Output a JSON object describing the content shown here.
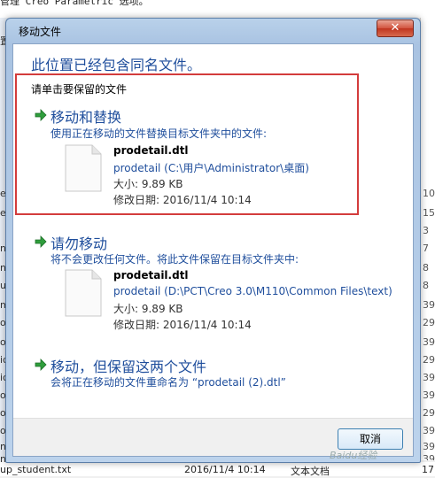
{
  "background": {
    "top_text": "管理 Creo Parametric 选项。",
    "left_snippets": [
      "置",
      "et",
      "et",
      "n_",
      "n_",
      "ug",
      "mp",
      "olu",
      "olu",
      "ic",
      "ic",
      "olg",
      "olg",
      "ol",
      "n_",
      "n_"
    ],
    "right_snippets": [
      "10",
      "15",
      "3",
      "7",
      "8",
      "8",
      "39",
      "29",
      "39",
      "29",
      "39",
      "39",
      "29",
      "39",
      "39",
      "39"
    ],
    "bottom_row": {
      "name": "up_student.txt",
      "date": "2016/11/4 10:14",
      "type": "文本文档",
      "size": "17"
    }
  },
  "dialog": {
    "title": "移动文件",
    "close_symbol": "✕",
    "heading": "此位置已经包含同名文件。",
    "instruction": "请单击要保留的文件",
    "options": [
      {
        "title": "移动和替换",
        "description": "使用正在移动的文件替换目标文件夹中的文件:",
        "file": {
          "name": "prodetail.dtl",
          "path": "prodetail (C:\\用户\\Administrator\\桌面)",
          "size": "大小: 9.89 KB",
          "modified": "修改日期: 2016/11/4 10:14"
        }
      },
      {
        "title": "请勿移动",
        "description": "将不会更改任何文件。将此文件保留在目标文件夹中:",
        "file": {
          "name": "prodetail.dtl",
          "path": "prodetail (D:\\PCT\\Creo 3.0\\M110\\Common Files\\text)",
          "size": "大小: 9.89 KB",
          "modified": "修改日期: 2016/11/4 10:14"
        }
      },
      {
        "title": "移动，但保留这两个文件",
        "description": "会将正在移动的文件重命名为 “prodetail (2).dtl”"
      }
    ],
    "cancel_label": "取消"
  },
  "watermark": "Baidu经验"
}
